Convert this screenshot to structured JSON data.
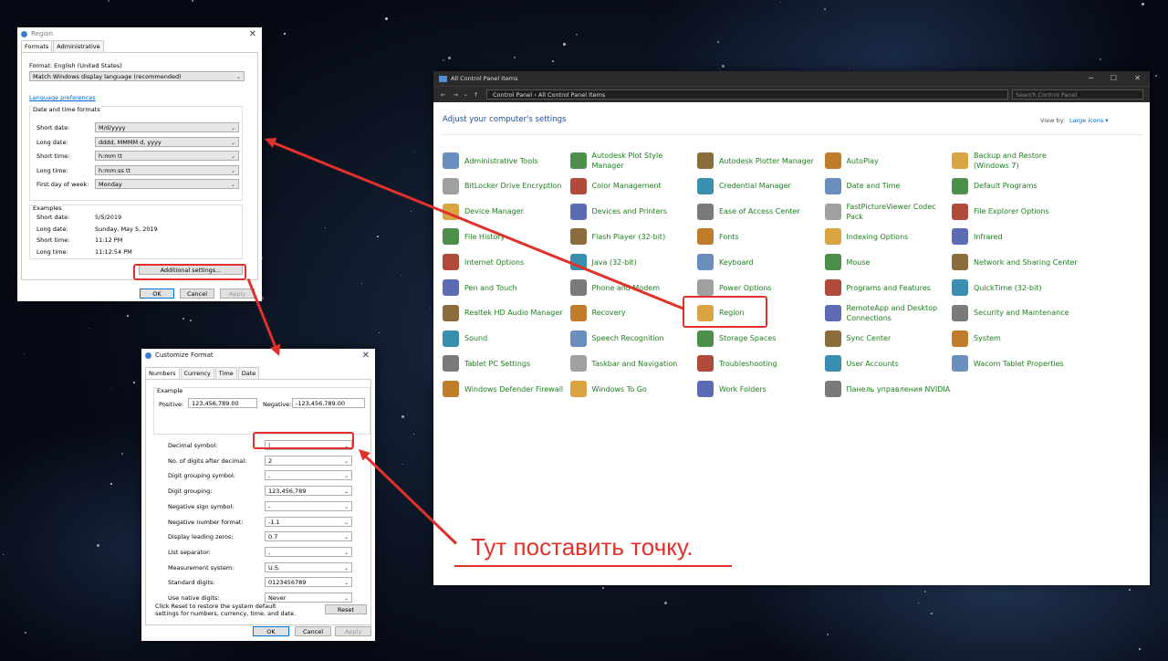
{
  "region_dialog": {
    "title": "Region",
    "tabs": [
      "Formats",
      "Administrative"
    ],
    "format_label": "Format: English (United States)",
    "format_value": "Match Windows display language (recommended)",
    "language_link": "Language preferences",
    "group_title": "Date and time formats",
    "rows": [
      {
        "label": "Short date:",
        "value": "M/d/yyyy"
      },
      {
        "label": "Long date:",
        "value": "dddd, MMMM d, yyyy"
      },
      {
        "label": "Short time:",
        "value": "h:mm tt"
      },
      {
        "label": "Long time:",
        "value": "h:mm:ss tt"
      },
      {
        "label": "First day of week:",
        "value": "Monday"
      }
    ],
    "examples_title": "Examples",
    "examples": [
      {
        "label": "Short date:",
        "value": "5/5/2019"
      },
      {
        "label": "Long date:",
        "value": "Sunday, May 5, 2019"
      },
      {
        "label": "Short time:",
        "value": "11:12 PM"
      },
      {
        "label": "Long time:",
        "value": "11:12:54 PM"
      }
    ],
    "additional_btn": "Additional settings...",
    "ok": "OK",
    "cancel": "Cancel",
    "apply": "Apply"
  },
  "customize_dialog": {
    "title": "Customize Format",
    "tabs": [
      "Numbers",
      "Currency",
      "Time",
      "Date"
    ],
    "example_title": "Example",
    "positive_label": "Positive:",
    "positive_value": "123,456,789.00",
    "negative_label": "Negative:",
    "negative_value": "-123,456,789.00",
    "rows": [
      {
        "label": "Decimal symbol:",
        "value": "|"
      },
      {
        "label": "No. of digits after decimal:",
        "value": "2"
      },
      {
        "label": "Digit grouping symbol:",
        "value": ","
      },
      {
        "label": "Digit grouping:",
        "value": "123,456,789"
      },
      {
        "label": "Negative sign symbol:",
        "value": "-"
      },
      {
        "label": "Negative number format:",
        "value": "-1.1"
      },
      {
        "label": "Display leading zeros:",
        "value": "0.7"
      },
      {
        "label": "List separator:",
        "value": ","
      },
      {
        "label": "Measurement system:",
        "value": "U.S."
      },
      {
        "label": "Standard digits:",
        "value": "0123456789"
      },
      {
        "label": "Use native digits:",
        "value": "Never"
      }
    ],
    "reset_note": "Click Reset to restore the system default settings for numbers, currency, time, and date.",
    "reset": "Reset",
    "ok": "OK",
    "cancel": "Cancel",
    "apply": "Apply"
  },
  "control_panel": {
    "title": "All Control Panel Items",
    "address": [
      "Control Panel",
      "All Control Panel Items"
    ],
    "search_placeholder": "Search Control Panel",
    "heading": "Adjust your computer's settings",
    "view_by_label": "View by:",
    "view_by_value": "Large icons ▾",
    "columns": [
      [
        "Administrative Tools",
        "BitLocker Drive Encryption",
        "Device Manager",
        "File History",
        "Internet Options",
        "Pen and Touch",
        "Realtek HD Audio Manager",
        "Sound",
        "Tablet PC Settings",
        "Windows Defender Firewall"
      ],
      [
        "Autodesk Plot Style Manager",
        "Color Management",
        "Devices and Printers",
        "Flash Player (32-bit)",
        "Java (32-bit)",
        "Phone and Modem",
        "Recovery",
        "Speech Recognition",
        "Taskbar and Navigation",
        "Windows To Go"
      ],
      [
        "Autodesk Plotter Manager",
        "Credential Manager",
        "Ease of Access Center",
        "Fonts",
        "Keyboard",
        "Power Options",
        "Region",
        "Storage Spaces",
        "Troubleshooting",
        "Work Folders"
      ],
      [
        "AutoPlay",
        "Date and Time",
        "FastPictureViewer Codec Pack",
        "Indexing Options",
        "Mouse",
        "Programs and Features",
        "RemoteApp and Desktop Connections",
        "Sync Center",
        "User Accounts",
        "Панель управления NVIDIA"
      ],
      [
        "Backup and Restore (Windows 7)",
        "Default Programs",
        "File Explorer Options",
        "Infrared",
        "Network and Sharing Center",
        "QuickTime (32-bit)",
        "Security and Maintenance",
        "System",
        "Wacom Tablet Properties"
      ]
    ]
  },
  "annotation": "Тут поставить точку.",
  "colors": {
    "accent_red": "#e0312a",
    "link_green": "#1e7e1e",
    "link_blue": "#0066cc"
  }
}
